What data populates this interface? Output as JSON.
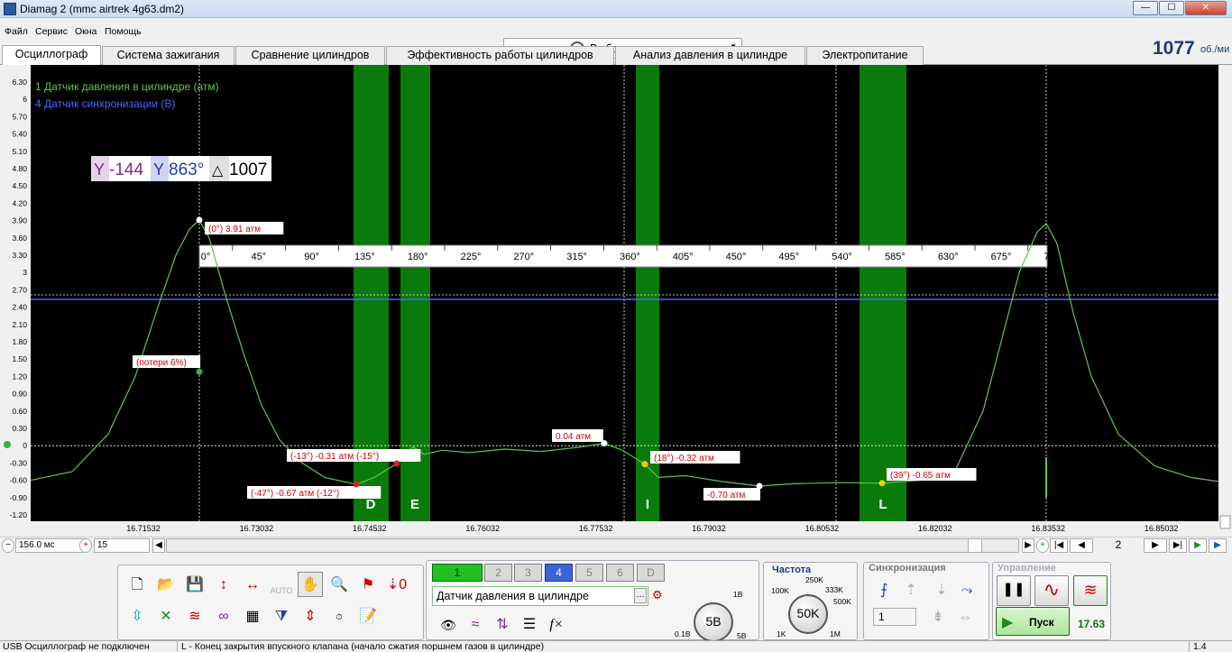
{
  "window": {
    "title": "Diamag 2 (mmc airtrek 4g63.dm2)",
    "min": "—",
    "max": "☐",
    "close": "✕"
  },
  "menu": {
    "items": [
      "Файл",
      "Сервис",
      "Окна",
      "Помощь"
    ]
  },
  "test_selector": {
    "label": "Выбор теста"
  },
  "rpm": {
    "value": "1077",
    "unit": "об./ми"
  },
  "tabs": [
    "Осциллограф",
    "Система зажигания",
    "Сравнение цилиндров",
    "Эффективность работы цилиндров",
    "Анализ давления в цилиндре",
    "Электропитание"
  ],
  "scope": {
    "channel1_label": "1 Датчик давления в цилиндре (атм)",
    "channel4_label": "4 Датчик синхронизации (В)",
    "marker_a": "-144",
    "marker_b": "863°",
    "marker_delta": "1007",
    "y_ticks": [
      "6.30",
      "6",
      "5.70",
      "5.40",
      "5.10",
      "4.80",
      "4.50",
      "4.20",
      "3.90",
      "3.60",
      "3.30",
      "3",
      "2.70",
      "2.40",
      "2.10",
      "1.80",
      "1.50",
      "1.20",
      "0.90",
      "0.60",
      "0.30",
      "0",
      "-0.30",
      "-0.60",
      "-0.90",
      "-1.20"
    ],
    "x_ticks": [
      "16.71532",
      "16.73032",
      "16.74532",
      "16.76032",
      "16.77532",
      "16.79032",
      "16.80532",
      "16.82032",
      "16.83532",
      "16.85032"
    ],
    "degree_ticks": [
      "0°",
      "45°",
      "90°",
      "135°",
      "180°",
      "225°",
      "270°",
      "315°",
      "360°",
      "405°",
      "450°",
      "495°",
      "540°",
      "585°",
      "630°",
      "675°",
      "720°"
    ],
    "phase_labels": [
      "D",
      "E",
      "I",
      "L"
    ],
    "annotations": [
      "(0°) 3.91 атм",
      "(потери 6%)",
      "(-13°) -0.31 атм (-15°)",
      "(-47°) -0.67 атм (-12°)",
      "0.04 атм",
      "(18°) -0.32 атм",
      "-0.70 атм",
      "(39°) -0.65 атм"
    ],
    "colors": {
      "trace": "#5ec64a",
      "sync": "#4a66ff",
      "band": "#0a7a0a",
      "annot": "#d00000"
    }
  },
  "scroll": {
    "time_per_div": "156.0 мс",
    "count": "15",
    "page": "2"
  },
  "toolbar": {
    "channels": [
      "1",
      "2",
      "3",
      "4",
      "5",
      "6",
      "D"
    ],
    "sensor_select": "Датчик давления в цилиндре",
    "volt_knob": {
      "value": "5В",
      "min": "0.1В",
      "mid": "1В",
      "max": "5В"
    },
    "freq": {
      "title": "Частота",
      "value": "50K",
      "l1": "100K",
      "l2": "250K",
      "l3": "333K",
      "l4": "500K",
      "l5": "1K",
      "l6": "1M"
    },
    "sync": {
      "title": "Синхронизация",
      "channel": "1"
    },
    "control": {
      "title": "Управление",
      "start": "Пуск",
      "fps": "17.63"
    }
  },
  "status": {
    "left": "USB Осциллограф не подключен",
    "mid": "L - Конец закрытия впускного клапана (начало сжатия поршнем газов в цилиндре)",
    "right": "1.4"
  }
}
